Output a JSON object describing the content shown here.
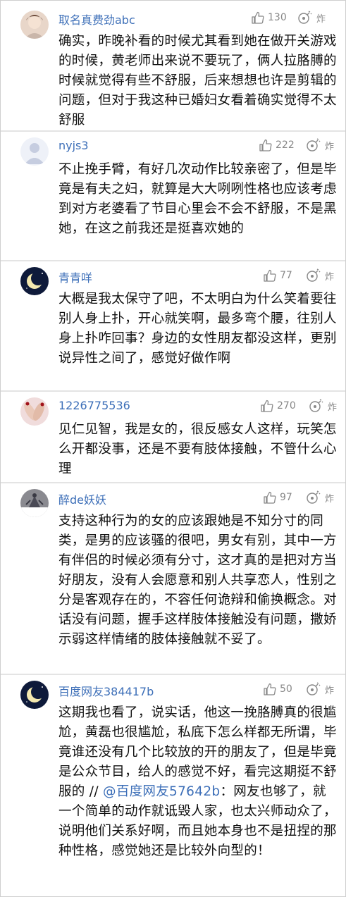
{
  "icons": {
    "like": "thumbs-up-icon",
    "bomb": "bomb-icon"
  },
  "colors": {
    "username": "#3d6fb8",
    "meta": "#888888",
    "text": "#111111",
    "divider": "#e4e4e4",
    "mention": "#3d6fb8"
  },
  "comments": [
    {
      "username": "取名真费劲abc",
      "likes": "130",
      "bomb_label": "炸",
      "text": "确实，昨晚补看的时候尤其看到她在做开关游戏的时候，黄老师出来说不要玩了，俩人拉胳膊的时候就觉得有些不舒服，后来想想也许是剪辑的问题，但对于我这种已婚妇女看着确实觉得不太舒服"
    },
    {
      "username": "nyjs3",
      "likes": "222",
      "bomb_label": "炸",
      "text": "不止挽手臂，有好几次动作比较亲密了，但是毕竟是有夫之妇，就算是大大咧咧性格也应该考虑到对方老婆看了节目心里会不会不舒服，不是黑她，在这之前我还是挺喜欢她的"
    },
    {
      "username": "青青咩",
      "likes": "77",
      "bomb_label": "炸",
      "text": "大概是我太保守了吧，不太明白为什么笑着要往别人身上扑，开心就笑啊，最多弯个腰，往别人身上扑咋回事？身边的女性朋友都没这样，更别说异性之间了，感觉好做作啊"
    },
    {
      "username": "1226775536",
      "likes": "270",
      "bomb_label": "炸",
      "text": "见仁见智，我是女的，很反感女人这样，玩笑怎么开都没事，还是不要有肢体接触，不管什么心理"
    },
    {
      "username": "醉de妖妖",
      "likes": "97",
      "bomb_label": "炸",
      "text": "支持这种行为的女的应该跟她是不知分寸的同类，是男的应该骚的很吧，男女有别，其中一方有伴侣的时候必须有分寸，这才真的是把对方当好朋友，没有人会愿意和别人共享恋人，性别之分是客观存在的，不容任何诡辩和偷换概念。对话没有问题，握手这样肢体接触没有问题，撒娇示弱这样情绪的肢体接触就不妥了。"
    },
    {
      "username": "百度网友384417b",
      "likes": "50",
      "bomb_label": "炸",
      "text_before": "这期我也看了，说实话，他这一挽胳膊真的很尴尬，黄磊也很尴尬，私底下怎么样都无所谓，毕竟谁还没有几个比较放的开的朋友了，但是毕竟是公众节目，给人的感觉不好，看完这期挺不舒服的 // ",
      "mention": "@百度网友57642b",
      "text_after": "：网友也够了，就一个简单的动作就诋毁人家，也太兴师动众了，说明他们关系好啊，而且她本身也不是扭捏的那种性格，感觉她还是比较外向型的！"
    }
  ]
}
